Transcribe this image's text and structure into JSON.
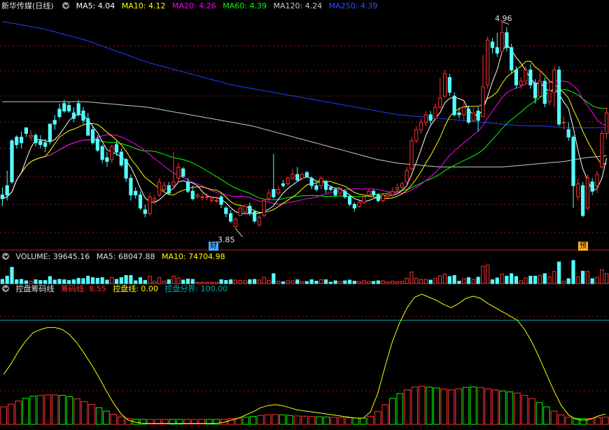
{
  "header": {
    "title": "新华传媒(日线)",
    "ma5": "MA5: 4.04",
    "ma10": "MA10: 4.12",
    "ma20": "MA20: 4.26",
    "ma60": "MA60: 4.39",
    "ma120": "MA120: 4.24",
    "ma250": "MA250: 4.39"
  },
  "volume_header": {
    "vol": "VOLUME: 39645.16",
    "ma5": "MA5: 68047.88",
    "ma10": "MA10: 74704.98"
  },
  "indicator_header": {
    "name": "控盘筹码线",
    "chip": "筹码线: 8.55",
    "ctrl": "控盘线: 0.00",
    "bound": "控盘分界: 100.00"
  },
  "annotations": {
    "high": "4.96",
    "low": "3.85",
    "badge_left": "财",
    "badge_right": "预"
  },
  "colors": {
    "up": "#ff3232",
    "down": "#54ffff",
    "ma5": "#ffffff",
    "ma10": "#ffff00",
    "ma20": "#ff00ff",
    "ma60": "#00ff00",
    "ma120": "#c8c8c8",
    "ma250": "#2040ff",
    "grid": "#8b1a1a",
    "boundary": "#00aaaa"
  },
  "chart_data": [
    {
      "type": "candlestick",
      "title": "新华传媒(日线)",
      "ylim": [
        3.78,
        5.0
      ],
      "grid": "dotted",
      "candles": [
        [
          4.03,
          4.01,
          4.07,
          3.97
        ],
        [
          4.08,
          4.03,
          4.16,
          4.0
        ],
        [
          4.32,
          4.1,
          4.33,
          4.09
        ],
        [
          4.34,
          4.3,
          4.35,
          4.28
        ],
        [
          4.34,
          4.31,
          4.37,
          4.28
        ],
        [
          4.39,
          4.36,
          4.39,
          4.34
        ],
        [
          4.34,
          4.35,
          4.38,
          4.32
        ],
        [
          4.35,
          4.31,
          4.36,
          4.29
        ],
        [
          4.32,
          4.3,
          4.35,
          4.28
        ],
        [
          4.31,
          4.29,
          4.33,
          4.26
        ],
        [
          4.41,
          4.32,
          4.41,
          4.3
        ],
        [
          4.43,
          4.41,
          4.46,
          4.38
        ],
        [
          4.49,
          4.45,
          4.52,
          4.44
        ],
        [
          4.52,
          4.48,
          4.54,
          4.47
        ],
        [
          4.51,
          4.48,
          4.53,
          4.47
        ],
        [
          4.47,
          4.44,
          4.5,
          4.42
        ],
        [
          4.52,
          4.46,
          4.54,
          4.45
        ],
        [
          4.48,
          4.43,
          4.5,
          4.41
        ],
        [
          4.44,
          4.35,
          4.47,
          4.35
        ],
        [
          4.38,
          4.31,
          4.4,
          4.3
        ],
        [
          4.33,
          4.27,
          4.35,
          4.26
        ],
        [
          4.29,
          4.22,
          4.3,
          4.2
        ],
        [
          4.23,
          4.21,
          4.26,
          4.18
        ],
        [
          4.22,
          4.29,
          4.3,
          4.2
        ],
        [
          4.3,
          4.26,
          4.32,
          4.24
        ],
        [
          4.26,
          4.19,
          4.28,
          4.18
        ],
        [
          4.22,
          4.12,
          4.23,
          4.1
        ],
        [
          4.12,
          4.03,
          4.14,
          4.0
        ],
        [
          4.05,
          4.03,
          4.07,
          4.01
        ],
        [
          4.03,
          3.96,
          4.05,
          3.95
        ],
        [
          3.95,
          3.93,
          3.98,
          3.91
        ],
        [
          3.93,
          4.02,
          4.04,
          3.92
        ],
        [
          4.0,
          4.01,
          4.03,
          3.98
        ],
        [
          4.03,
          4.1,
          4.12,
          4.02
        ],
        [
          4.06,
          4.08,
          4.1,
          4.05
        ],
        [
          4.08,
          4.04,
          4.1,
          4.03
        ],
        [
          4.08,
          4.1,
          4.26,
          4.07
        ],
        [
          4.12,
          4.18,
          4.2,
          4.1
        ],
        [
          4.17,
          4.13,
          4.18,
          4.12
        ],
        [
          4.1,
          4.05,
          4.12,
          4.04
        ],
        [
          4.05,
          4.01,
          4.08,
          4.0
        ],
        [
          4.02,
          4.03,
          4.04,
          4.01
        ],
        [
          4.02,
          4.02,
          4.04,
          4.0
        ],
        [
          4.02,
          4.02,
          4.04,
          4.0
        ],
        [
          4.0,
          4.01,
          4.02,
          3.99
        ],
        [
          4.0,
          4.0,
          4.02,
          3.99
        ],
        [
          4.02,
          3.98,
          4.03,
          3.96
        ],
        [
          3.96,
          3.93,
          3.97,
          3.91
        ],
        [
          3.93,
          3.89,
          3.95,
          3.88
        ],
        [
          3.86,
          3.9,
          3.91,
          3.85
        ],
        [
          3.92,
          3.96,
          3.97,
          3.92
        ],
        [
          3.94,
          3.97,
          3.98,
          3.93
        ],
        [
          3.97,
          3.93,
          3.99,
          3.92
        ],
        [
          3.94,
          3.89,
          3.95,
          3.88
        ],
        [
          3.87,
          3.91,
          3.92,
          3.86
        ],
        [
          3.92,
          4.0,
          4.01,
          3.91
        ],
        [
          4.01,
          4.04,
          4.06,
          4.0
        ],
        [
          4.06,
          4.02,
          4.25,
          4.01
        ],
        [
          4.04,
          4.06,
          4.08,
          4.03
        ],
        [
          4.09,
          4.08,
          4.11,
          4.07
        ],
        [
          4.09,
          4.12,
          4.13,
          4.08
        ],
        [
          4.12,
          4.14,
          4.17,
          4.11
        ],
        [
          4.14,
          4.11,
          4.18,
          4.1
        ],
        [
          4.12,
          4.14,
          4.15,
          4.11
        ],
        [
          4.15,
          4.13,
          4.16,
          4.12
        ],
        [
          4.12,
          4.08,
          4.13,
          4.06
        ],
        [
          4.08,
          4.06,
          4.1,
          4.05
        ],
        [
          4.08,
          4.12,
          4.13,
          4.06
        ],
        [
          4.1,
          4.06,
          4.11,
          4.04
        ],
        [
          4.07,
          4.06,
          4.08,
          4.05
        ],
        [
          4.06,
          4.03,
          4.07,
          4.02
        ],
        [
          4.04,
          4.06,
          4.07,
          4.03
        ],
        [
          4.05,
          4.02,
          4.06,
          4.01
        ],
        [
          4.02,
          3.98,
          4.03,
          3.97
        ],
        [
          3.98,
          3.96,
          3.99,
          3.94
        ],
        [
          3.97,
          3.99,
          4.0,
          3.96
        ],
        [
          3.99,
          4.02,
          4.03,
          3.98
        ],
        [
          4.03,
          4.05,
          4.06,
          4.02
        ],
        [
          4.05,
          4.03,
          4.06,
          4.02
        ],
        [
          4.03,
          4.0,
          4.04,
          3.99
        ],
        [
          4.0,
          4.03,
          4.04,
          3.99
        ],
        [
          4.02,
          4.03,
          4.05,
          4.01
        ],
        [
          4.03,
          4.05,
          4.07,
          4.02
        ],
        [
          4.06,
          4.07,
          4.09,
          4.05
        ],
        [
          4.07,
          4.09,
          4.1,
          4.06
        ],
        [
          4.1,
          4.16,
          4.18,
          4.09
        ],
        [
          4.17,
          4.32,
          4.34,
          4.16
        ],
        [
          4.32,
          4.38,
          4.4,
          4.31
        ],
        [
          4.38,
          4.42,
          4.44,
          4.36
        ],
        [
          4.42,
          4.46,
          4.48,
          4.4
        ],
        [
          4.46,
          4.43,
          4.48,
          4.41
        ],
        [
          4.44,
          4.5,
          4.52,
          4.43
        ],
        [
          4.5,
          4.55,
          4.66,
          4.49
        ],
        [
          4.56,
          4.68,
          4.7,
          4.55
        ],
        [
          4.66,
          4.58,
          4.68,
          4.56
        ],
        [
          4.56,
          4.46,
          4.58,
          4.45
        ],
        [
          4.47,
          4.46,
          4.5,
          4.44
        ],
        [
          4.46,
          4.5,
          4.53,
          4.43
        ],
        [
          4.49,
          4.42,
          4.51,
          4.41
        ],
        [
          4.43,
          4.47,
          4.5,
          4.42
        ],
        [
          4.48,
          4.43,
          4.5,
          4.37
        ],
        [
          4.45,
          4.61,
          4.78,
          4.45
        ],
        [
          4.62,
          4.86,
          4.88,
          4.6
        ],
        [
          4.85,
          4.82,
          4.87,
          4.79
        ],
        [
          4.82,
          4.79,
          4.9,
          4.77
        ],
        [
          4.8,
          4.9,
          4.96,
          4.79
        ],
        [
          4.9,
          4.82,
          4.93,
          4.8
        ],
        [
          4.82,
          4.7,
          4.84,
          4.68
        ],
        [
          4.7,
          4.62,
          4.72,
          4.6
        ],
        [
          4.62,
          4.64,
          4.66,
          4.6
        ],
        [
          4.64,
          4.7,
          4.72,
          4.62
        ],
        [
          4.7,
          4.62,
          4.73,
          4.6
        ],
        [
          4.63,
          4.55,
          4.65,
          4.52
        ],
        [
          4.56,
          4.64,
          4.7,
          4.55
        ],
        [
          4.64,
          4.52,
          4.66,
          4.5
        ],
        [
          4.53,
          4.59,
          4.64,
          4.51
        ],
        [
          4.58,
          4.7,
          4.72,
          4.5
        ],
        [
          4.7,
          4.41,
          4.72,
          4.4
        ],
        [
          4.42,
          4.42,
          4.45,
          4.38
        ],
        [
          4.38,
          4.34,
          4.42,
          4.32
        ],
        [
          4.34,
          4.08,
          4.35,
          3.96
        ],
        [
          4.02,
          4.09,
          4.12,
          4.0
        ],
        [
          4.08,
          3.92,
          4.1,
          3.91
        ],
        [
          3.96,
          4.12,
          4.14,
          3.95
        ],
        [
          4.1,
          4.05,
          4.12,
          4.03
        ],
        [
          4.08,
          4.14,
          4.16,
          4.04
        ],
        [
          4.18,
          4.36,
          4.38,
          4.17
        ],
        [
          4.36,
          4.47,
          4.5,
          4.33
        ]
      ],
      "series_current": {
        "MA5": 4.04,
        "MA10": 4.12,
        "MA20": 4.26,
        "MA60": 4.39,
        "MA120": 4.24,
        "MA250": 4.39
      },
      "ma120": [
        4.53,
        4.53,
        4.53,
        4.53,
        4.53,
        4.52,
        4.51,
        4.5,
        4.48,
        4.46,
        4.44,
        4.42,
        4.4,
        4.37,
        4.34,
        4.31,
        4.28,
        4.25,
        4.22,
        4.2,
        4.19,
        4.18,
        4.18,
        4.18,
        4.18,
        4.19,
        4.2,
        4.21,
        4.23,
        4.24
      ],
      "ma250": [
        4.96,
        4.94,
        4.92,
        4.89,
        4.86,
        4.82,
        4.78,
        4.74,
        4.71,
        4.68,
        4.65,
        4.62,
        4.6,
        4.58,
        4.56,
        4.54,
        4.52,
        4.5,
        4.48,
        4.46,
        4.45,
        4.44,
        4.43,
        4.42,
        4.41,
        4.4,
        4.4,
        4.39,
        4.39,
        4.39
      ],
      "high_marker": {
        "index": 105,
        "value": 4.96
      },
      "low_marker": {
        "index": 49,
        "value": 3.85
      }
    },
    {
      "type": "bar",
      "title": "VOLUME",
      "values_from_candles": true,
      "latest": 39645.16,
      "ma5": 68047.88,
      "ma10": 74704.98
    },
    {
      "type": "line",
      "title": "控盘筹码线",
      "ylim": [
        0,
        125
      ],
      "boundary": 100,
      "chip_line": [
        48,
        58,
        70,
        80,
        88,
        91,
        93,
        93,
        91,
        86,
        78,
        68,
        57,
        45,
        32,
        20,
        10,
        4,
        2,
        1,
        1,
        1,
        1,
        1,
        1,
        1,
        1,
        1,
        1,
        1,
        2,
        4,
        6,
        9,
        12,
        16,
        18,
        19,
        18,
        16,
        14,
        13,
        12,
        11,
        10,
        9,
        8,
        7,
        6,
        6,
        12,
        30,
        56,
        80,
        98,
        112,
        122,
        125,
        122,
        119,
        115,
        112,
        116,
        121,
        123,
        121,
        116,
        112,
        108,
        104,
        100,
        91,
        79,
        64,
        48,
        32,
        18,
        9,
        5,
        4,
        5,
        8,
        10
      ]
    }
  ]
}
